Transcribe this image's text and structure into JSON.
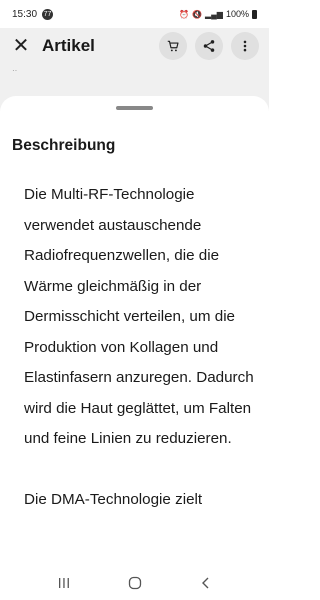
{
  "status_bar": {
    "time": "15:30",
    "notification_count": "77",
    "battery": "100%"
  },
  "app_bar": {
    "title": "Artikel",
    "icons": [
      "close-icon",
      "cart-icon",
      "share-icon",
      "more-vert-icon"
    ]
  },
  "background": {
    "dots": "··"
  },
  "sheet": {
    "title": "Beschreibung",
    "paragraphs": [
      "Die Multi-RF-Technologie verwendet austauschende Radiofrequenzwellen, die die Wärme gleichmäßig in der Dermisschicht verteilen, um die Produktion von Kollagen und Elastinfasern anzuregen. Dadurch wird die Haut geglättet, um Falten und feine Linien zu reduzieren.",
      "Die DMA-Technologie zielt"
    ]
  },
  "nav_bar": {
    "icons": [
      "recents-icon",
      "home-icon",
      "back-icon"
    ]
  },
  "colors": {
    "text": "#1a1a1a",
    "icon_bg": "#eeeeee",
    "handle": "#888888"
  }
}
